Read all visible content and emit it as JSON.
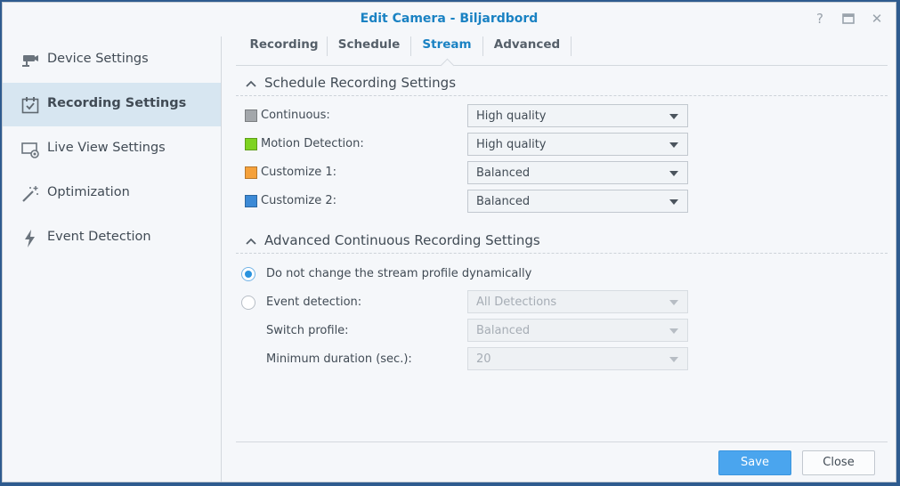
{
  "window": {
    "title": "Edit Camera - Biljardbord",
    "help_glyph": "?",
    "maximize_glyph": "▭",
    "close_glyph": "✕"
  },
  "sidebar": {
    "items": [
      {
        "label": "Device Settings",
        "icon": "camera-icon"
      },
      {
        "label": "Recording Settings",
        "icon": "calendar-check-icon",
        "active": true
      },
      {
        "label": "Live View Settings",
        "icon": "monitor-eye-icon"
      },
      {
        "label": "Optimization",
        "icon": "magic-wand-icon"
      },
      {
        "label": "Event Detection",
        "icon": "lightning-icon"
      }
    ]
  },
  "tabs": [
    {
      "label": "Recording"
    },
    {
      "label": "Schedule"
    },
    {
      "label": "Stream",
      "active": true
    },
    {
      "label": "Advanced"
    }
  ],
  "schedule_section": {
    "title": "Schedule Recording Settings",
    "rows": [
      {
        "label": "Continuous:",
        "color": "#a3a7ab",
        "value": "High quality"
      },
      {
        "label": "Motion Detection:",
        "color": "#7ed321",
        "value": "High quality"
      },
      {
        "label": "Customize 1:",
        "color": "#f5a13b",
        "value": "Balanced"
      },
      {
        "label": "Customize 2:",
        "color": "#3c8ad6",
        "value": "Balanced"
      }
    ]
  },
  "advanced_section": {
    "title": "Advanced Continuous Recording Settings",
    "radio_static": "Do not change the stream profile dynamically",
    "radio_event": "Event detection:",
    "event_value": "All Detections",
    "switch_label": "Switch profile:",
    "switch_value": "Balanced",
    "min_label": "Minimum duration (sec.):",
    "min_value": "20"
  },
  "footer": {
    "save_label": "Save",
    "close_label": "Close"
  },
  "colors": {
    "accent": "#1a82c3",
    "primary_button": "#4aa5ee"
  }
}
